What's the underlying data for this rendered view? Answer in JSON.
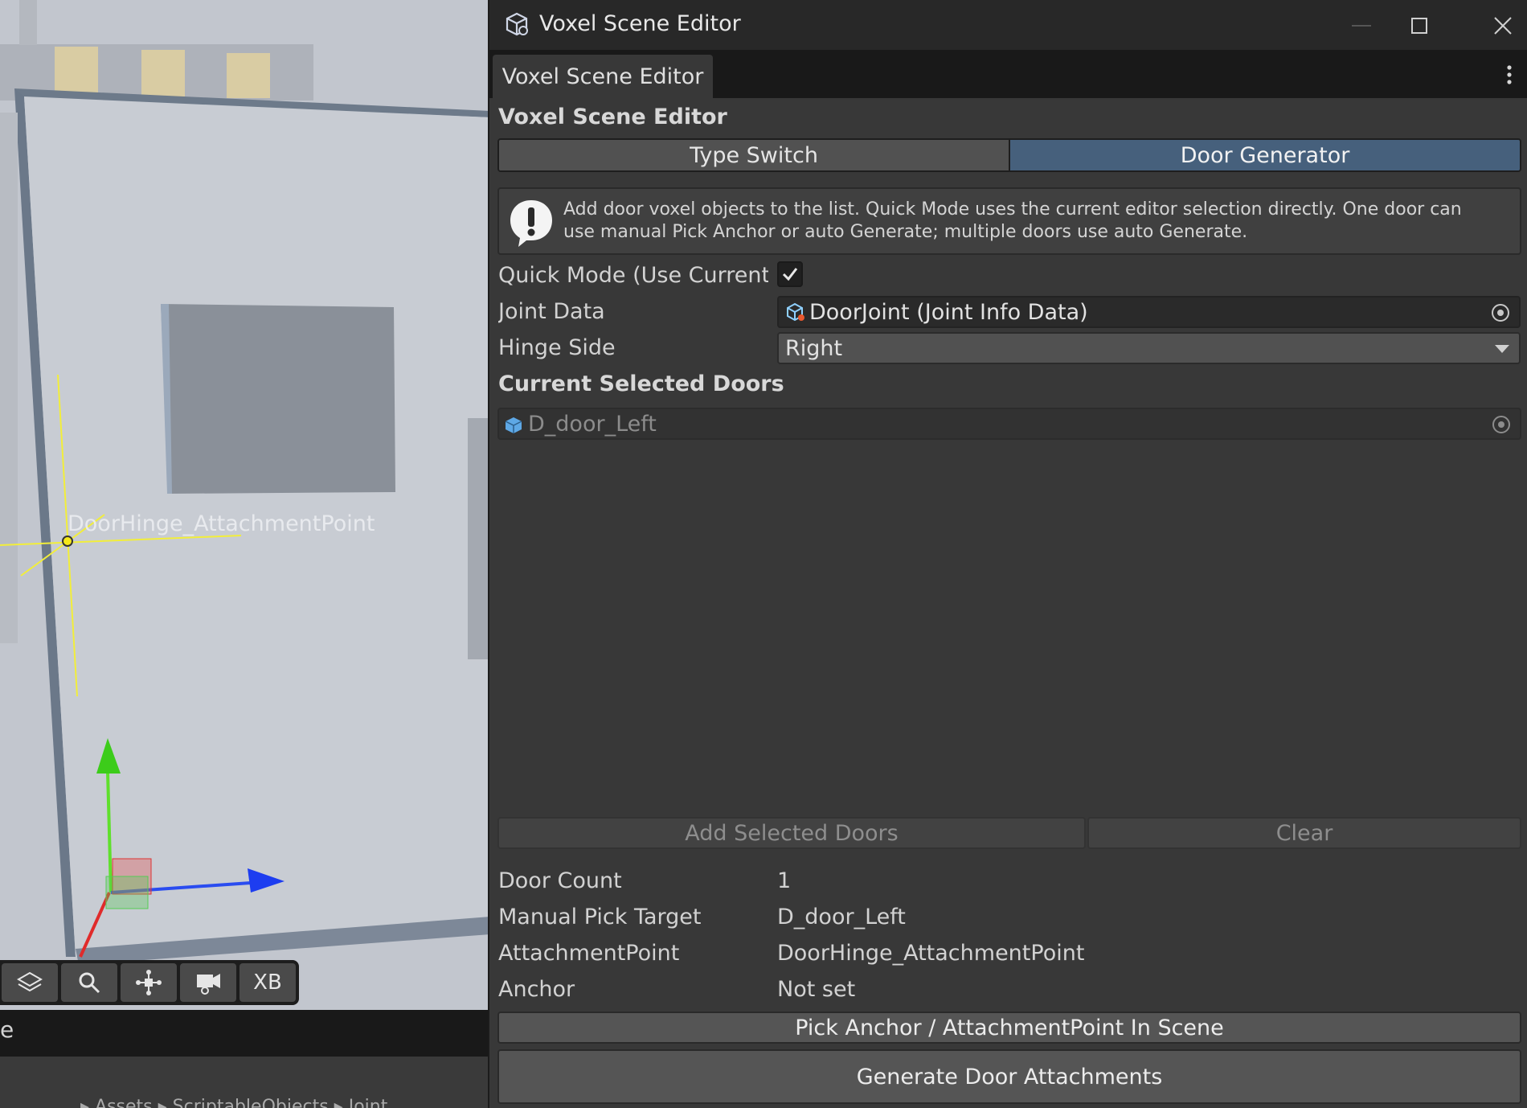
{
  "scene": {
    "object_label": "DoorHinge_AttachmentPoint",
    "toolbar": {
      "xb_label": "XB"
    },
    "bottom_bar_text": "e",
    "footer_breadcrumb": "▸ Assets ▸ ScriptableObjects ▸ Joint"
  },
  "window": {
    "title": "Voxel Scene Editor",
    "tab_label": "Voxel Scene Editor"
  },
  "editor": {
    "heading": "Voxel Scene Editor",
    "mode_tabs": [
      {
        "label": "Type Switch",
        "active": false
      },
      {
        "label": "Door Generator",
        "active": true
      }
    ],
    "help_message": "Add door voxel objects to the list. Quick Mode uses the current editor selection directly. One door can use manual Pick Anchor or auto Generate; multiple doors use auto Generate.",
    "quick_mode": {
      "label": "Quick Mode (Use Current Selection)",
      "checked": true
    },
    "joint_data": {
      "label": "Joint Data",
      "value": "DoorJoint (Joint Info Data)"
    },
    "hinge_side": {
      "label": "Hinge Side",
      "value": "Right"
    },
    "current_selected_heading": "Current Selected Doors",
    "selected_doors": [
      "D_door_Left"
    ],
    "add_selected_label": "Add Selected Doors",
    "clear_label": "Clear",
    "info": {
      "door_count_label": "Door Count",
      "door_count_value": "1",
      "manual_pick_label": "Manual Pick Target",
      "manual_pick_value": "D_door_Left",
      "attachment_label": "AttachmentPoint",
      "attachment_value": "DoorHinge_AttachmentPoint",
      "anchor_label": "Anchor",
      "anchor_value": "Not set"
    },
    "pick_anchor_label": "Pick Anchor / AttachmentPoint In Scene",
    "generate_label": "Generate Door Attachments"
  },
  "colors": {
    "active_tab": "#46607c",
    "panel_bg": "#383838",
    "title_bg": "#282828"
  }
}
